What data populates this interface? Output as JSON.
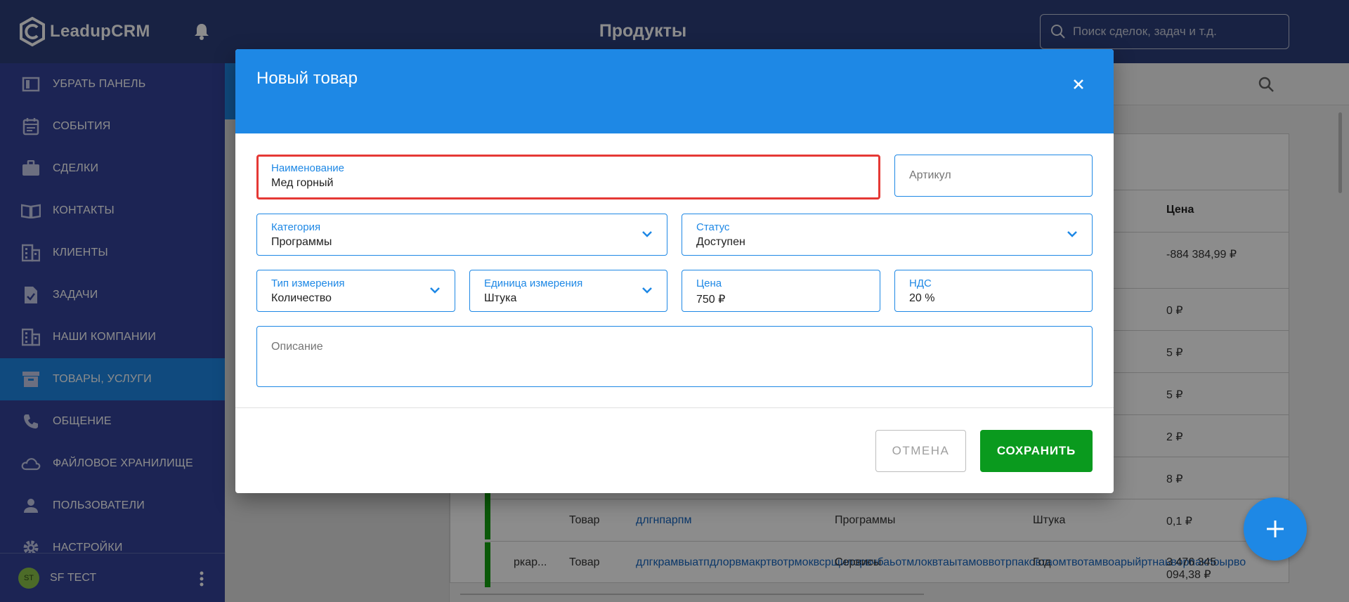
{
  "app": {
    "logo_text": "LeadupCRM",
    "page_title": "Продукты"
  },
  "search": {
    "placeholder": "Поиск сделок, задач и т.д."
  },
  "sidebar": {
    "items": [
      {
        "label": "УБРАТЬ ПАНЕЛЬ",
        "icon": "panel-icon"
      },
      {
        "label": "СОБЫТИЯ",
        "icon": "calendar-icon"
      },
      {
        "label": "СДЕЛКИ",
        "icon": "briefcase-icon"
      },
      {
        "label": "КОНТАКТЫ",
        "icon": "book-icon"
      },
      {
        "label": "КЛИЕНТЫ",
        "icon": "building-icon"
      },
      {
        "label": "ЗАДАЧИ",
        "icon": "task-icon"
      },
      {
        "label": "НАШИ КОМПАНИИ",
        "icon": "company-icon"
      },
      {
        "label": "ТОВАРЫ, УСЛУГИ",
        "icon": "archive-icon",
        "active": true
      },
      {
        "label": "ОБЩЕНИЕ",
        "icon": "phone-icon"
      },
      {
        "label": "ФАЙЛОВОЕ ХРАНИЛИЩЕ",
        "icon": "cloud-icon"
      },
      {
        "label": "ПОЛЬЗОВАТЕЛИ",
        "icon": "person-icon"
      },
      {
        "label": "НАСТРОЙКИ",
        "icon": "gear-icon"
      }
    ],
    "user": {
      "initials": "ST",
      "name": "SF ТЕСТ"
    }
  },
  "table": {
    "price_header": "Цена",
    "prices": [
      "-884 384,99 ₽",
      "0 ₽",
      "5 ₽",
      "5 ₽",
      "2 ₽",
      "8 ₽",
      "0,1 ₽"
    ],
    "row7": {
      "type": "Товар",
      "name": "длгнпарпм",
      "category": "Программы",
      "unit": "Штука"
    },
    "row8": {
      "code": "ркар...",
      "type": "Товар",
      "name": "длгкрамвыатпдлорвмакртвотрмоквсрщилорвчбаьотмлоквтаытамоввотрпаковтаомтвотамвоарыйртнаьворпаклоырво",
      "category": "Сервисы",
      "unit": "Год",
      "price": "3 476 345 094,38 ₽"
    }
  },
  "dialog": {
    "title": "Новый товар",
    "name": {
      "label": "Наименование",
      "value": "Мед горный"
    },
    "article": {
      "placeholder": "Артикул"
    },
    "category": {
      "label": "Категория",
      "value": "Программы"
    },
    "status": {
      "label": "Статус",
      "value": "Доступен"
    },
    "measure_type": {
      "label": "Тип измерения",
      "value": "Количество"
    },
    "unit": {
      "label": "Единица измерения",
      "value": "Штука"
    },
    "price": {
      "label": "Цена",
      "value": "750 ₽"
    },
    "vat": {
      "label": "НДС",
      "value": "20 %"
    },
    "description": {
      "placeholder": "Описание"
    },
    "cancel_label": "ОТМЕНА",
    "save_label": "СОХРАНИТЬ"
  },
  "colors": {
    "header": "#2c3e7a",
    "sidebar": "#34439a",
    "accent": "#1e88e5",
    "save": "#0a9a1e",
    "error": "#e53935"
  }
}
